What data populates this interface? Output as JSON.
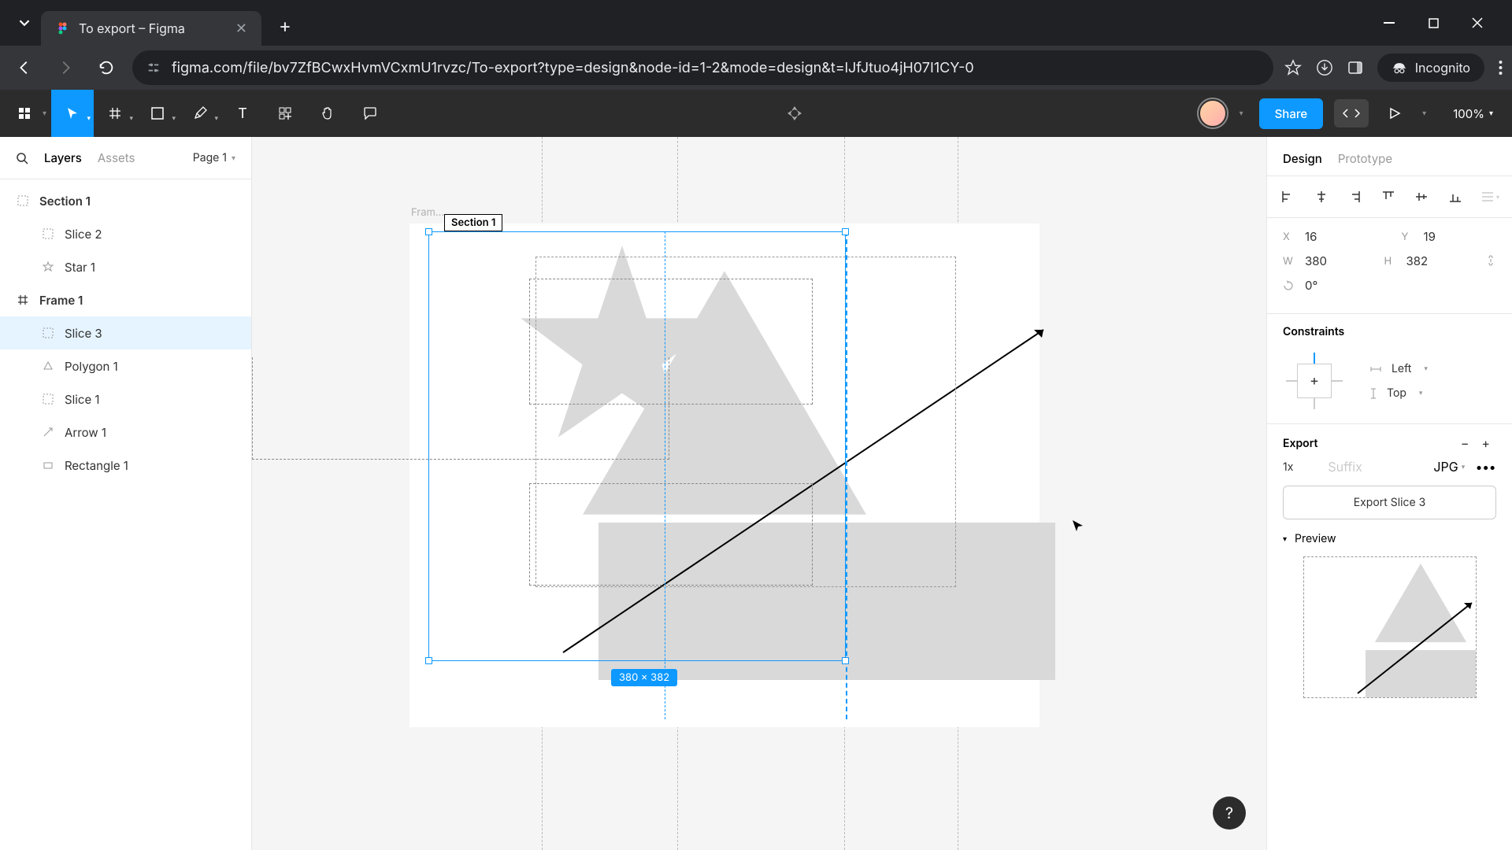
{
  "browser": {
    "tab_title": "To export – Figma",
    "url": "figma.com/file/bv7ZfBCwxHvmVCxmU1rvzc/To-export?type=design&node-id=1-2&mode=design&t=lJfJtuo4jH07I1CY-0",
    "incognito_label": "Incognito"
  },
  "figma": {
    "share_label": "Share",
    "zoom_label": "100%"
  },
  "left": {
    "layers_tab": "Layers",
    "assets_tab": "Assets",
    "page_label": "Page 1",
    "tree": {
      "section1": "Section 1",
      "slice2": "Slice 2",
      "star1": "Star 1",
      "frame1": "Frame 1",
      "slice3": "Slice 3",
      "polygon1": "Polygon 1",
      "slice1": "Slice 1",
      "arrow1": "Arrow 1",
      "rectangle1": "Rectangle 1"
    }
  },
  "canvas": {
    "frame_label": "Fram...",
    "section_label": "Section 1",
    "dim_badge": "380 × 382"
  },
  "right": {
    "design_tab": "Design",
    "prototype_tab": "Prototype",
    "transform": {
      "x_label": "X",
      "x_value": "16",
      "y_label": "Y",
      "y_value": "19",
      "w_label": "W",
      "w_value": "380",
      "h_label": "H",
      "h_value": "382",
      "r_value": "0°"
    },
    "constraints": {
      "title": "Constraints",
      "h_value": "Left",
      "v_value": "Top"
    },
    "export": {
      "title": "Export",
      "scale": "1x",
      "suffix_placeholder": "Suffix",
      "format": "JPG",
      "button_label": "Export Slice 3",
      "preview_label": "Preview"
    }
  }
}
